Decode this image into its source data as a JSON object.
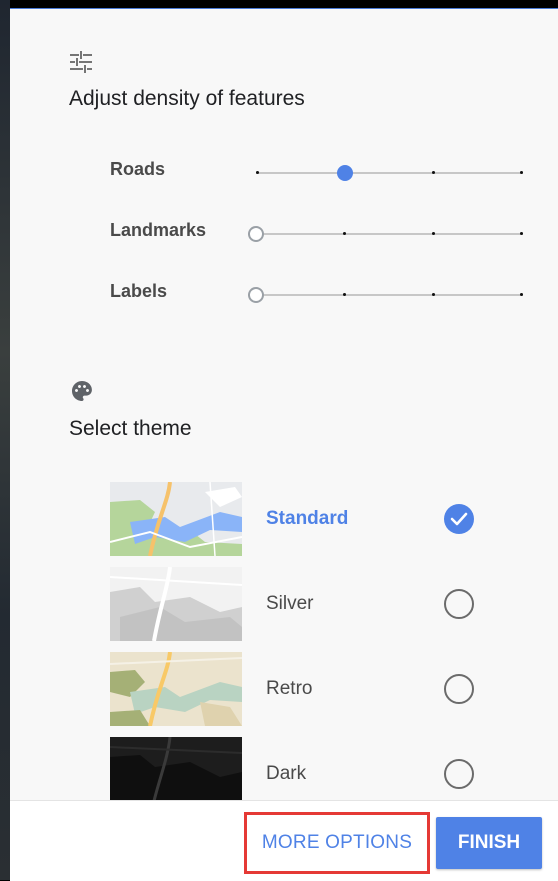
{
  "density": {
    "title": "Adjust density of features",
    "icon": "tune-sliders-icon",
    "rows": [
      {
        "label": "Roads",
        "level": 1,
        "steps": 4
      },
      {
        "label": "Landmarks",
        "level": 0,
        "steps": 4
      },
      {
        "label": "Labels",
        "level": 0,
        "steps": 4
      }
    ]
  },
  "theme": {
    "title": "Select theme",
    "icon": "palette-icon",
    "options": [
      {
        "name": "Standard",
        "selected": true
      },
      {
        "name": "Silver",
        "selected": false
      },
      {
        "name": "Retro",
        "selected": false
      },
      {
        "name": "Dark",
        "selected": false
      }
    ]
  },
  "footer": {
    "more_options_label": "MORE OPTIONS",
    "finish_label": "FINISH"
  },
  "colors": {
    "accent": "#4f82e6",
    "highlight_box": "#e53935"
  }
}
